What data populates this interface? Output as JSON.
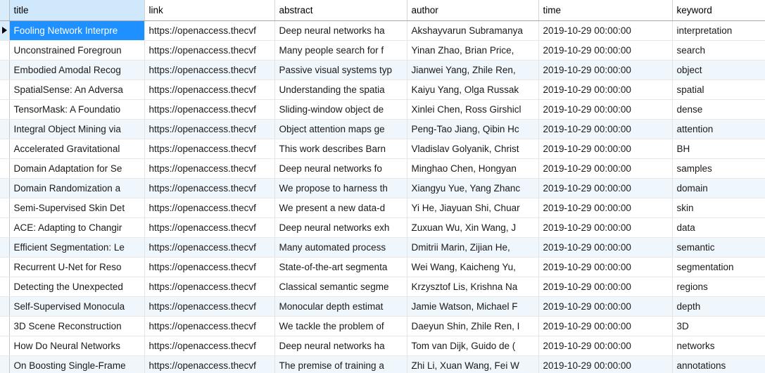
{
  "grid": {
    "row_indicator_icon": "current-row-arrow-icon",
    "selected_row_index": 0,
    "selected_column": "title",
    "selection_color": "#1e90ff",
    "header_selected_color": "#cfe8fb",
    "alt_row_color": "#eff6fc",
    "columns": [
      {
        "key": "title",
        "label": "title"
      },
      {
        "key": "link",
        "label": "link"
      },
      {
        "key": "abstract",
        "label": "abstract"
      },
      {
        "key": "author",
        "label": "author"
      },
      {
        "key": "time",
        "label": "time"
      },
      {
        "key": "keyword",
        "label": "keyword"
      }
    ],
    "rows": [
      {
        "title": "Fooling Network Interpre",
        "link": "https://openaccess.thecvf",
        "abstract": "Deep neural networks ha",
        "author": "Akshayvarun Subramanya",
        "time": "2019-10-29 00:00:00",
        "keyword": "interpretation"
      },
      {
        "title": "Unconstrained Foregroun",
        "link": "https://openaccess.thecvf",
        "abstract": "Many people search for f",
        "author": "Yinan Zhao,  Brian Price,",
        "time": "2019-10-29 00:00:00",
        "keyword": "search"
      },
      {
        "title": "Embodied Amodal Recog",
        "link": "https://openaccess.thecvf",
        "abstract": "Passive visual systems typ",
        "author": "Jianwei Yang,  Zhile Ren,",
        "time": "2019-10-29 00:00:00",
        "keyword": "object"
      },
      {
        "title": "SpatialSense: An Adversa",
        "link": "https://openaccess.thecvf",
        "abstract": "Understanding the spatia",
        "author": "Kaiyu Yang,  Olga Russak",
        "time": "2019-10-29 00:00:00",
        "keyword": "spatial"
      },
      {
        "title": "TensorMask: A Foundatio",
        "link": "https://openaccess.thecvf",
        "abstract": "Sliding-window object de",
        "author": "Xinlei Chen,  Ross Girshicl",
        "time": "2019-10-29 00:00:00",
        "keyword": "dense"
      },
      {
        "title": "Integral Object Mining via",
        "link": "https://openaccess.thecvf",
        "abstract": "Object attention maps ge",
        "author": "Peng-Tao Jiang,  Qibin Hc",
        "time": "2019-10-29 00:00:00",
        "keyword": "attention"
      },
      {
        "title": "Accelerated Gravitational",
        "link": "https://openaccess.thecvf",
        "abstract": "This work describes Barn",
        "author": "Vladislav Golyanik,  Christ",
        "time": "2019-10-29 00:00:00",
        "keyword": "BH"
      },
      {
        "title": "Domain Adaptation for Sе",
        "link": "https://openaccess.thecvf",
        "abstract": " Deep neural networks fo",
        "author": "Minghao Chen,  Hongyan",
        "time": "2019-10-29 00:00:00",
        "keyword": "samples"
      },
      {
        "title": "Domain Randomization a",
        "link": "https://openaccess.thecvf",
        "abstract": "We propose to harness th",
        "author": "Xiangyu Yue,  Yang Zhanc",
        "time": "2019-10-29 00:00:00",
        "keyword": "domain"
      },
      {
        "title": "Semi-Supervised Skin Det",
        "link": "https://openaccess.thecvf",
        "abstract": "We present a new data-d",
        "author": "Yi He,  Jiayuan Shi,  Chuar",
        "time": "2019-10-29 00:00:00",
        "keyword": "skin"
      },
      {
        "title": "ACE: Adapting to Changir",
        "link": "https://openaccess.thecvf",
        "abstract": "Deep neural networks exh",
        "author": "Zuxuan Wu,  Xin Wang,  J",
        "time": "2019-10-29 00:00:00",
        "keyword": "data"
      },
      {
        "title": "Efficient Segmentation: Le",
        "link": "https://openaccess.thecvf",
        "abstract": "Many automated process",
        "author": "Dmitrii Marin,  Zijian He,",
        "time": "2019-10-29 00:00:00",
        "keyword": "semantic"
      },
      {
        "title": "Recurrent U-Net for Reso",
        "link": "https://openaccess.thecvf",
        "abstract": "State-of-the-art segmenta",
        "author": "Wei Wang,  Kaicheng Yu,",
        "time": "2019-10-29 00:00:00",
        "keyword": "segmentation"
      },
      {
        "title": "Detecting the Unexpected",
        "link": "https://openaccess.thecvf",
        "abstract": "Classical semantic segme",
        "author": "Krzysztof Lis,  Krishna Na",
        "time": "2019-10-29 00:00:00",
        "keyword": "regions"
      },
      {
        "title": "Self-Supervised Monoculа",
        "link": "https://openaccess.thecvf",
        "abstract": "Monocular depth estimat",
        "author": "Jamie Watson,  Michael F",
        "time": "2019-10-29 00:00:00",
        "keyword": "depth"
      },
      {
        "title": "3D Scene Reconstruction",
        "link": "https://openaccess.thecvf",
        "abstract": "We tackle the problem of",
        "author": "Daeyun Shin,  Zhile Ren,  I",
        "time": "2019-10-29 00:00:00",
        "keyword": "3D"
      },
      {
        "title": "How Do Neural Networks",
        "link": "https://openaccess.thecvf",
        "abstract": "Deep neural networks ha",
        "author": "Tom van Dijk,  Guido de (",
        "time": "2019-10-29 00:00:00",
        "keyword": "networks"
      },
      {
        "title": "On Boosting Single-Framе",
        "link": "https://openaccess.thecvf",
        "abstract": "The premise of training a",
        "author": "Zhi Li,  Xuan Wang,  Fei W",
        "time": "2019-10-29 00:00:00",
        "keyword": "annotations"
      }
    ]
  }
}
